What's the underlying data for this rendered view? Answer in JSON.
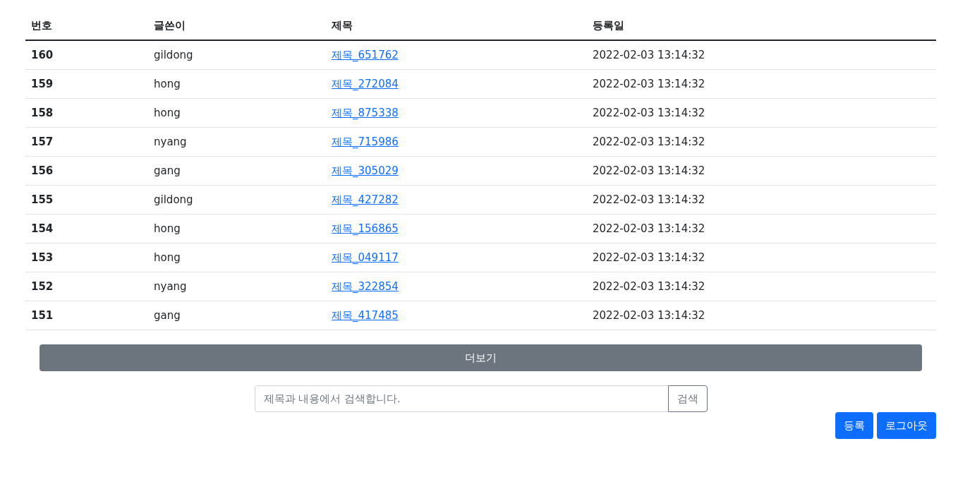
{
  "table": {
    "columns": [
      "번호",
      "글쓴이",
      "제목",
      "등록일"
    ],
    "rows": [
      {
        "number": "160",
        "author": "gildong",
        "title": "제목_651762",
        "date": "2022-02-03 13:14:32"
      },
      {
        "number": "159",
        "author": "hong",
        "title": "제목_272084",
        "date": "2022-02-03 13:14:32"
      },
      {
        "number": "158",
        "author": "hong",
        "title": "제목_875338",
        "date": "2022-02-03 13:14:32"
      },
      {
        "number": "157",
        "author": "nyang",
        "title": "제목_715986",
        "date": "2022-02-03 13:14:32"
      },
      {
        "number": "156",
        "author": "gang",
        "title": "제목_305029",
        "date": "2022-02-03 13:14:32"
      },
      {
        "number": "155",
        "author": "gildong",
        "title": "제목_427282",
        "date": "2022-02-03 13:14:32"
      },
      {
        "number": "154",
        "author": "hong",
        "title": "제목_156865",
        "date": "2022-02-03 13:14:32"
      },
      {
        "number": "153",
        "author": "hong",
        "title": "제목_049117",
        "date": "2022-02-03 13:14:32"
      },
      {
        "number": "152",
        "author": "nyang",
        "title": "제목_322854",
        "date": "2022-02-03 13:14:32"
      },
      {
        "number": "151",
        "author": "gang",
        "title": "제목_417485",
        "date": "2022-02-03 13:14:32"
      }
    ]
  },
  "more_button": "더보기",
  "search": {
    "placeholder": "제목과 내용에서 검색합니다.",
    "button": "검색"
  },
  "actions": [
    "등록",
    "로그아웃"
  ]
}
